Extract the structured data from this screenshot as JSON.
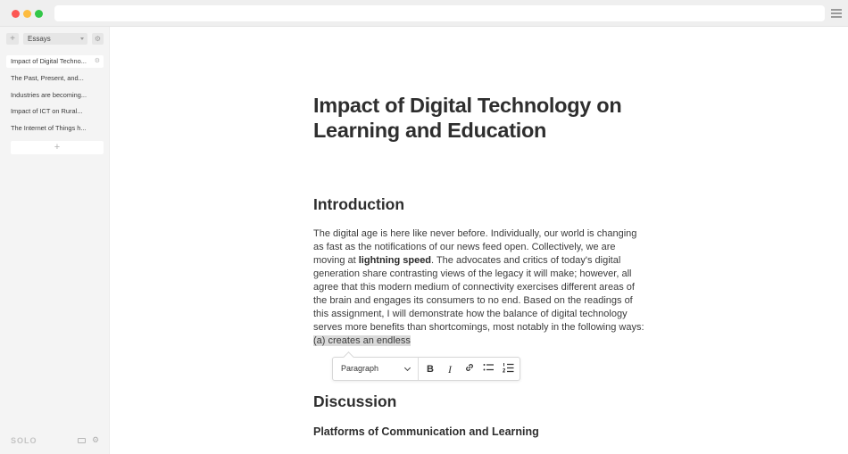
{
  "window": {
    "colors": {
      "close": "#fc5753",
      "minimize": "#fdbc40",
      "maximize": "#33c748"
    }
  },
  "sidebar": {
    "collection": "Essays",
    "documents": [
      {
        "title": "Impact of Digital Techno..."
      },
      {
        "title": "The Past, Present, and..."
      },
      {
        "title": "Industries are becoming..."
      },
      {
        "title": "Impact of ICT on Rural..."
      },
      {
        "title": "The Internet of Things h..."
      }
    ],
    "add_label": "+",
    "logo": "SOLO"
  },
  "document": {
    "title": "Impact of Digital Technology on Learning and Education",
    "h2_intro": "Introduction",
    "para_before_bold": "The digital age is here like never before. Individually, our world is changing as fast as the notifications of our news feed open. Collectively, we are moving at ",
    "para_bold": "lightning speed",
    "para_after_bold": ". The advocates and critics of today's digital generation share contrasting views of the legacy it will make; however, all agree that this modern medium of connectivity exercises different areas of the brain and engages its consumers to no end. Based on the readings of this assignment, I will demonstrate how the balance of digital technology serves more benefits than shortcomings, most notably in the following ways: ",
    "para_selected": "(a) creates an endless",
    "h2_discussion": "Discussion",
    "h3_platforms": "Platforms of Communication and Learning"
  },
  "toolbar": {
    "block_type": "Paragraph",
    "buttons": [
      "bold",
      "italic",
      "link",
      "bullet-list",
      "numbered-list"
    ]
  }
}
